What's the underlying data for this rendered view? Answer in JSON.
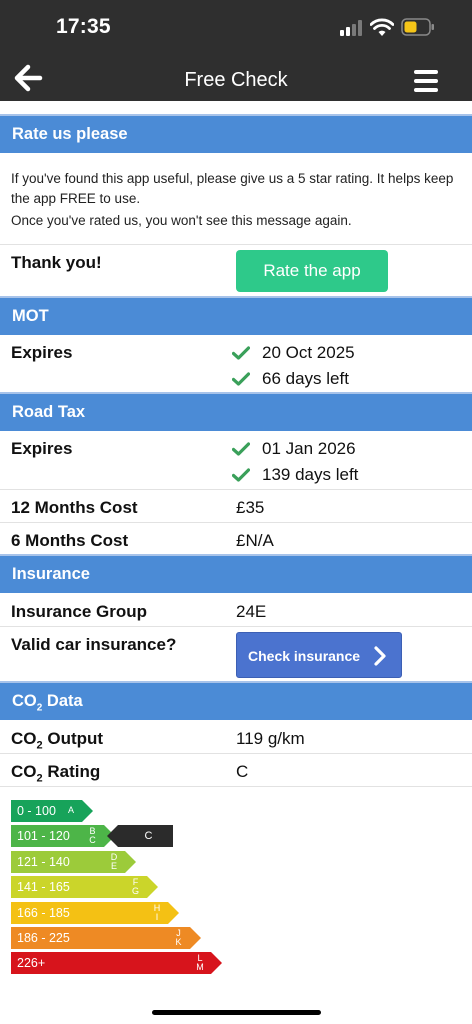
{
  "status_bar": {
    "time": "17:35"
  },
  "nav": {
    "title": "Free Check"
  },
  "rate": {
    "header": "Rate us please",
    "text1": "If you've found this app useful, please give us a 5 star rating. It helps keep the app FREE to use.",
    "text2": "Once you've rated us, you won't see this message again.",
    "thanks": "Thank you!",
    "button": "Rate the app"
  },
  "mot": {
    "header": "MOT",
    "expires_label": "Expires",
    "expiry_date": "20 Oct 2025",
    "days_left": "66 days left"
  },
  "road_tax": {
    "header": "Road Tax",
    "expires_label": "Expires",
    "expiry_date": "01 Jan 2026",
    "days_left": "139 days left",
    "cost12_label": "12 Months Cost",
    "cost12": "£35",
    "cost6_label": "6 Months Cost",
    "cost6": "£N/A"
  },
  "insurance": {
    "header": "Insurance",
    "group_label": "Insurance Group",
    "group": "24E",
    "valid_label": "Valid car insurance?",
    "button": "Check insurance"
  },
  "co2": {
    "header_prefix": "CO",
    "header_sub": "2",
    "header_suffix": " Data",
    "output_prefix": "CO",
    "output_sub": "2",
    "output_suffix": " Output",
    "output": "119 g/km",
    "rating_prefix": "CO",
    "rating_sub": "2",
    "rating_suffix": " Rating",
    "rating": "C",
    "current_marker": "C",
    "bands": [
      {
        "range": "0 - 100",
        "letters": [
          "A"
        ],
        "color": "#17a35a"
      },
      {
        "range": "101 - 120",
        "letters": [
          "B",
          "C"
        ],
        "color": "#4db548"
      },
      {
        "range": "121 - 140",
        "letters": [
          "D",
          "E"
        ],
        "color": "#9ccb3a"
      },
      {
        "range": "141 - 165",
        "letters": [
          "F",
          "G"
        ],
        "color": "#cbd52a"
      },
      {
        "range": "166 - 185",
        "letters": [
          "H",
          "I"
        ],
        "color": "#f4c114"
      },
      {
        "range": "186 - 225",
        "letters": [
          "J",
          "K"
        ],
        "color": "#ee8a24"
      },
      {
        "range": "226+",
        "letters": [
          "L",
          "M"
        ],
        "color": "#d7141c"
      }
    ]
  },
  "colors": {
    "header_blue": "#4b8bd6",
    "check_green": "#3aa05a",
    "rate_button": "#2ec98a",
    "insurance_button": "#4b73cf"
  }
}
